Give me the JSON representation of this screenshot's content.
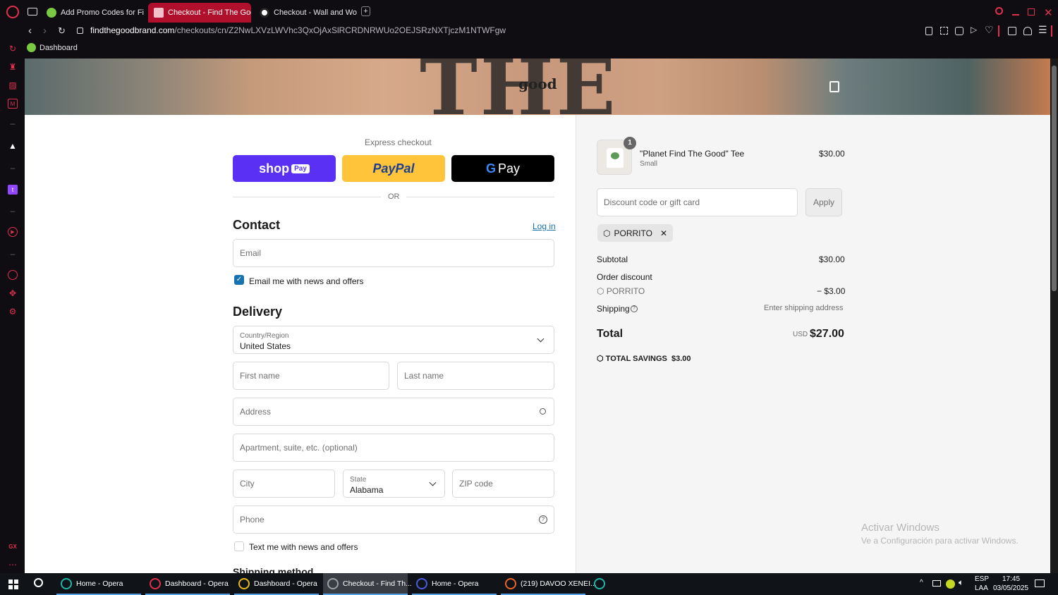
{
  "browser": {
    "tabs": [
      {
        "title": "Add Promo Codes for Find",
        "active": false
      },
      {
        "title": "Checkout - Find The Goo",
        "active": true
      },
      {
        "title": "Checkout - Wall and Won",
        "active": false
      }
    ],
    "new_tab_glyph": "+",
    "url_host": "findthegoodbrand.com",
    "url_path": "/checkouts/cn/Z2NwLXVzLWVhc3QxOjAxSlRCRDNRWUo2OEJSRzNXTjczM1NTWFgw",
    "bookmark_label": "Dashboard",
    "accent_color": "#b0102b"
  },
  "hero": {
    "bg_word": "THE",
    "logo_text": "good",
    "cart_icon": "shopping-bag-icon"
  },
  "checkout": {
    "express_label": "Express checkout",
    "shop_pay": "shop",
    "shop_pay_badge": "Pay",
    "paypal": "PayPal",
    "gpay_g": "G",
    "gpay": "Pay",
    "or_label": "OR",
    "contact_heading": "Contact",
    "login_link": "Log in",
    "email_placeholder": "Email",
    "email_news_label": "Email me with news and offers",
    "email_news_checked": true,
    "delivery_heading": "Delivery",
    "country_label": "Country/Region",
    "country_value": "United States",
    "first_name_placeholder": "First name",
    "last_name_placeholder": "Last name",
    "address_placeholder": "Address",
    "apartment_placeholder": "Apartment, suite, etc. (optional)",
    "city_placeholder": "City",
    "state_label": "State",
    "state_value": "Alabama",
    "zip_placeholder": "ZIP code",
    "phone_placeholder": "Phone",
    "text_news_label": "Text me with news and offers",
    "text_news_checked": false,
    "shipping_method_heading": "Shipping method"
  },
  "summary": {
    "item_qty": "1",
    "item_name": "\"Planet Find The Good\" Tee",
    "item_variant": "Small",
    "item_price": "$30.00",
    "discount_placeholder": "Discount code or gift card",
    "apply_label": "Apply",
    "applied_code": "PORRITO",
    "subtotal_label": "Subtotal",
    "subtotal_value": "$30.00",
    "order_discount_label": "Order discount",
    "discount_code": "PORRITO",
    "discount_value": "− $3.00",
    "shipping_label": "Shipping",
    "shipping_value": "Enter shipping address",
    "total_label": "Total",
    "currency": "USD",
    "total_value": "$27.00",
    "savings_label": "TOTAL SAVINGS",
    "savings_value": "$3.00"
  },
  "watermark": {
    "line1": "Activar Windows",
    "line2": "Ve a Configuración para activar Windows."
  },
  "taskbar": {
    "items": [
      {
        "label": "Home - Opera",
        "color": "#1fb7a6"
      },
      {
        "label": "Dashboard - Opera",
        "color": "#e0304e"
      },
      {
        "label": "Dashboard - Opera",
        "color": "#e6b91f"
      },
      {
        "label": "Checkout - Find Th...",
        "color": "#9aa0a6"
      },
      {
        "label": "Home - Opera",
        "color": "#4a5de0"
      },
      {
        "label": "(219) DAVOO XENEI...",
        "color": "#e8662a"
      }
    ],
    "lang_top": "ESP",
    "lang_bottom": "LAA",
    "time": "17:45",
    "date": "03/05/2025"
  }
}
